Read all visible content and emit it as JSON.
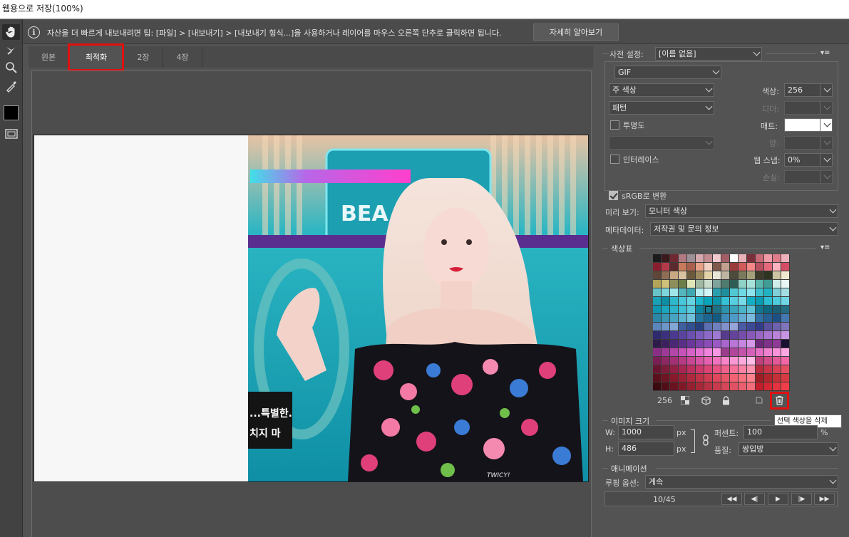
{
  "window": {
    "title": "웹용으로 저장(100%)"
  },
  "infobar": {
    "icon": "info-icon",
    "tip": "자산을 더 빠르게 내보내려면 팁: [파일] > [내보내기] > [내보내기 형식...]을 사용하거나 레이어를 마우스 오른쪽 단추로 클릭하면 됩니다.",
    "learn_more": "자세히 알아보기"
  },
  "tools": [
    "hand-tool-icon",
    "slice-select-tool-icon",
    "zoom-tool-icon",
    "eyedropper-tool-icon",
    "eyedropper-color-swatch",
    "toggle-slices-icon"
  ],
  "tabs": [
    {
      "label": "원본",
      "active": false
    },
    {
      "label": "최적화",
      "active": true
    },
    {
      "label": "2장",
      "active": false
    },
    {
      "label": "4장",
      "active": false
    }
  ],
  "preview": {
    "caption_line1": "...특별한.",
    "caption_line2": "치지 마",
    "watermark": "TWICY!",
    "sign_text": "BEA"
  },
  "settings": {
    "preset_label": "사전 설정:",
    "preset_value": "[이름 없음]",
    "format_value": "GIF",
    "reduction_value": "주 색상",
    "colors_label": "색상:",
    "colors_value": "256",
    "dither_method_value": "패턴",
    "dither_label": "디더:",
    "dither_value": "",
    "transparency_label": "투명도",
    "transparency_checked": false,
    "matte_label": "매트:",
    "matte_color": "#ffffff",
    "transparency_dither_value": "",
    "amount_label": "양:",
    "amount_value": "",
    "interlaced_label": "인터레이스",
    "interlaced_checked": false,
    "websnap_label": "웹 스냅:",
    "websnap_value": "0%",
    "lossy_label": "손실:",
    "lossy_value": "",
    "srgb_label": "sRGB로 변환",
    "srgb_checked": true,
    "preview_label": "미리 보기:",
    "preview_value": "모니터 색상",
    "metadata_label": "메타데이터:",
    "metadata_value": "저작권 및 문의 정보"
  },
  "color_table": {
    "title": "색상표",
    "count": "256",
    "delete_tooltip": "선택 색상을 삭제",
    "swatches": [
      "#1b1b1b",
      "#3a1a1c",
      "#6e2a30",
      "#b07a82",
      "#9c8f96",
      "#d6a7ad",
      "#c48b91",
      "#f2c9cf",
      "#a35d66",
      "#ffffff",
      "#e8b2b8",
      "#7b2f3a",
      "#c96b77",
      "#f09aa6",
      "#e17c8a",
      "#f0b0bb",
      "#8b1e2e",
      "#b43a4a",
      "#5a2a2e",
      "#c77b5b",
      "#a8604d",
      "#e6a186",
      "#f2d0c2",
      "#7f5a4c",
      "#c2a090",
      "#9a3b3b",
      "#d45a5a",
      "#f48787",
      "#b8505f",
      "#e5697a",
      "#ffb3c1",
      "#d44d65",
      "#5e4638",
      "#8f6e55",
      "#c8a882",
      "#d9c29e",
      "#6b5a3c",
      "#9d8b5f",
      "#e2d4a8",
      "#e9e6d8",
      "#bdb4a1",
      "#4b4a3b",
      "#7a7a5c",
      "#a6a07a",
      "#3d3a2a",
      "#2d3420",
      "#ccc4a0",
      "#f1e9cf",
      "#b2a45a",
      "#cfc07a",
      "#8d8f5b",
      "#6e7e49",
      "#e1e6b9",
      "#a1b9a3",
      "#c9dccb",
      "#7fa39a",
      "#4f7b6f",
      "#2e5d55",
      "#8fd1c6",
      "#a7e2da",
      "#5bb7ad",
      "#3f9d96",
      "#cfeeea",
      "#e7f6f4",
      "#67c3c8",
      "#7ed6dc",
      "#9ee6ea",
      "#55b6bd",
      "#3ea7b1",
      "#b8eef1",
      "#d4f5f7",
      "#28a0ad",
      "#1e8f9d",
      "#4fc9d4",
      "#6edbe4",
      "#8ee4ec",
      "#3bbfcc",
      "#22b3c2",
      "#7fd0d8",
      "#a4dde3",
      "#1aa1b5",
      "#0d8ea3",
      "#2fb8cc",
      "#47c7d9",
      "#66d3e2",
      "#1db6cc",
      "#08a6bd",
      "#0b93a8",
      "#34c2d6",
      "#57cfe0",
      "#79dbea",
      "#12aec4",
      "#0a9cb2",
      "#2cbdd2",
      "#4ecbdd",
      "#70d6e6",
      "#0f97b0",
      "#1aa6be",
      "#2cb3ca",
      "#3dbfd5",
      "#5ac9dc",
      "#0c86a0",
      "#167d94",
      "#1f6f85",
      "#2b93ab",
      "#39a4bc",
      "#4cb4cb",
      "#60c2d7",
      "#127591",
      "#0e6680",
      "#1b5d74",
      "#246b83",
      "#2c86a6",
      "#3895b4",
      "#47a4c2",
      "#5ab2ce",
      "#6fc0d9",
      "#2477a0",
      "#1a6690",
      "#145a80",
      "#3e8bbb",
      "#4f9bc8",
      "#63abd3",
      "#78b9dc",
      "#2f6fa3",
      "#255f93",
      "#1c5084",
      "#4676b0",
      "#5a86bd",
      "#6d96c9",
      "#82a7d4",
      "#3f5f9f",
      "#334f8f",
      "#274080",
      "#5b6fb3",
      "#6e80c0",
      "#8292cc",
      "#97a4d7",
      "#4c5aa6",
      "#3f4a97",
      "#333c88",
      "#59509e",
      "#6c62ad",
      "#7f75bb",
      "#2d2a6e",
      "#3a307d",
      "#49398f",
      "#5a44a0",
      "#6b50b0",
      "#7c5dbd",
      "#8d6ac9",
      "#9e79d3",
      "#563a8c",
      "#65429c",
      "#764dab",
      "#8859b8",
      "#9966c4",
      "#a974cf",
      "#b883d8",
      "#c694e0",
      "#2e1b4a",
      "#3c2060",
      "#4b2775",
      "#5a2f88",
      "#6a389a",
      "#7a42aa",
      "#8a4db8",
      "#9a59c4",
      "#aa66cf",
      "#b975d8",
      "#c786e0",
      "#d498e7",
      "#6e2a7a",
      "#7e3289",
      "#8e3b98",
      "#1a1030",
      "#8b2f86",
      "#a03a98",
      "#b446aa",
      "#c653b9",
      "#d662c7",
      "#e472d3",
      "#ef84dd",
      "#f797e6",
      "#9c3c8c",
      "#b0479c",
      "#c353ab",
      "#d461b8",
      "#e370c4",
      "#ef81cf",
      "#f893d9",
      "#fca6e2",
      "#7a1f55",
      "#8f2764",
      "#a33074",
      "#b63a84",
      "#c84694",
      "#d853a3",
      "#e662b1",
      "#f172be",
      "#f884ca",
      "#fc97d5",
      "#ffaadf",
      "#ffbde7",
      "#c0407a",
      "#d24b89",
      "#e25898",
      "#f066a6",
      "#6a1530",
      "#7f1b3a",
      "#941f45",
      "#a82651",
      "#bb2e5d",
      "#cc3869",
      "#db4475",
      "#e85181",
      "#f2608d",
      "#f87099",
      "#fc82a5",
      "#ff94b1",
      "#b72a3e",
      "#c9344a",
      "#d84056",
      "#e54d62",
      "#5a0f1c",
      "#701423",
      "#861a2b",
      "#9b2034",
      "#af283d",
      "#c13147",
      "#d13b51",
      "#df475c",
      "#ea5467",
      "#f36273",
      "#f9717f",
      "#fe818c",
      "#9f1d24",
      "#b3252d",
      "#c52f37",
      "#d53a42",
      "#3b0a10",
      "#520e17",
      "#69131f",
      "#7f1927",
      "#942030",
      "#a72839",
      "#b83143",
      "#c73b4d",
      "#d44658",
      "#e05263",
      "#ea5f6e",
      "#f26d7a",
      "#c21d2a",
      "#d42733",
      "#e4323e",
      "#f23e49"
    ]
  },
  "image_size": {
    "title": "이미지 크기",
    "w_label": "W:",
    "w_value": "1000",
    "h_label": "H:",
    "h_value": "486",
    "px": "px",
    "percent_label": "퍼센트:",
    "percent_value": "100",
    "percent_unit": "%",
    "quality_label": "품질:",
    "quality_value": "쌍입방"
  },
  "animation": {
    "title": "애니메이션",
    "loop_label": "루핑 옵션:",
    "loop_value": "계속",
    "frame_counter": "10/45",
    "buttons": [
      "◀◀",
      "◀|",
      "▶",
      "|▶",
      "▶▶"
    ]
  }
}
